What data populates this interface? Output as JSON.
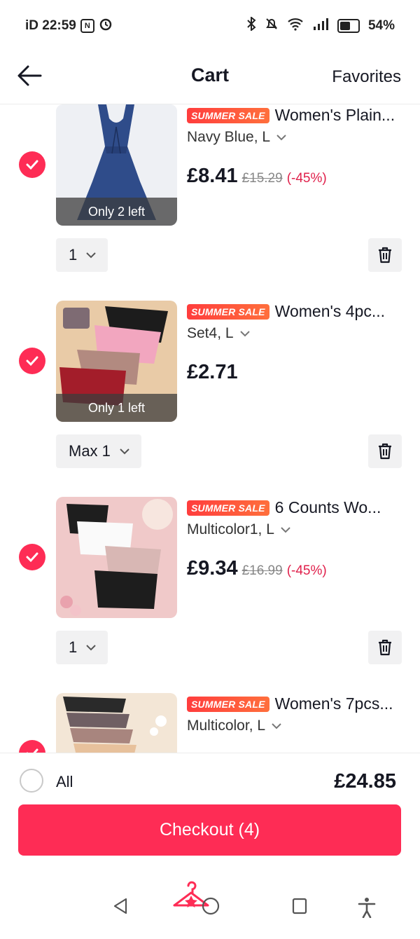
{
  "status_bar": {
    "time": "iD 22:59",
    "battery": "54%"
  },
  "header": {
    "title": "Cart",
    "favorites_label": "Favorites"
  },
  "items": [
    {
      "badge": "SUMMER SALE",
      "title": "Women's Plain...",
      "variant": "Navy Blue, L",
      "price": "£8.41",
      "original_price": "£15.29",
      "discount": "(-45%)",
      "stock": "Only 2 left",
      "quantity": "1",
      "checked": true
    },
    {
      "badge": "SUMMER SALE",
      "title": "Women's 4pc...",
      "variant": "Set4, L",
      "price": "£2.71",
      "original_price": "",
      "discount": "",
      "stock": "Only 1 left",
      "quantity": "Max 1",
      "checked": true
    },
    {
      "badge": "SUMMER SALE",
      "title": "6 Counts Wo...",
      "variant": "Multicolor1, L",
      "price": "£9.34",
      "original_price": "£16.99",
      "discount": "(-45%)",
      "stock": "",
      "quantity": "1",
      "checked": true
    },
    {
      "badge": "SUMMER SALE",
      "title": "Women's 7pcs...",
      "variant": "Multicolor, L",
      "price": "",
      "original_price": "",
      "discount": "",
      "stock": "",
      "quantity": "",
      "checked": true
    }
  ],
  "footer": {
    "all_label": "All",
    "total": "£24.85",
    "checkout_label": "Checkout (4)"
  },
  "colors": {
    "accent": "#fe2c55",
    "discount": "#e0204b",
    "sale_badge": "#ff4d3d"
  },
  "icons": [
    "back-arrow-icon",
    "checkmark-icon",
    "chevron-down-icon",
    "trash-icon",
    "hanger-icon",
    "nav-back-icon",
    "nav-home-icon",
    "nav-recents-icon",
    "accessibility-icon"
  ]
}
